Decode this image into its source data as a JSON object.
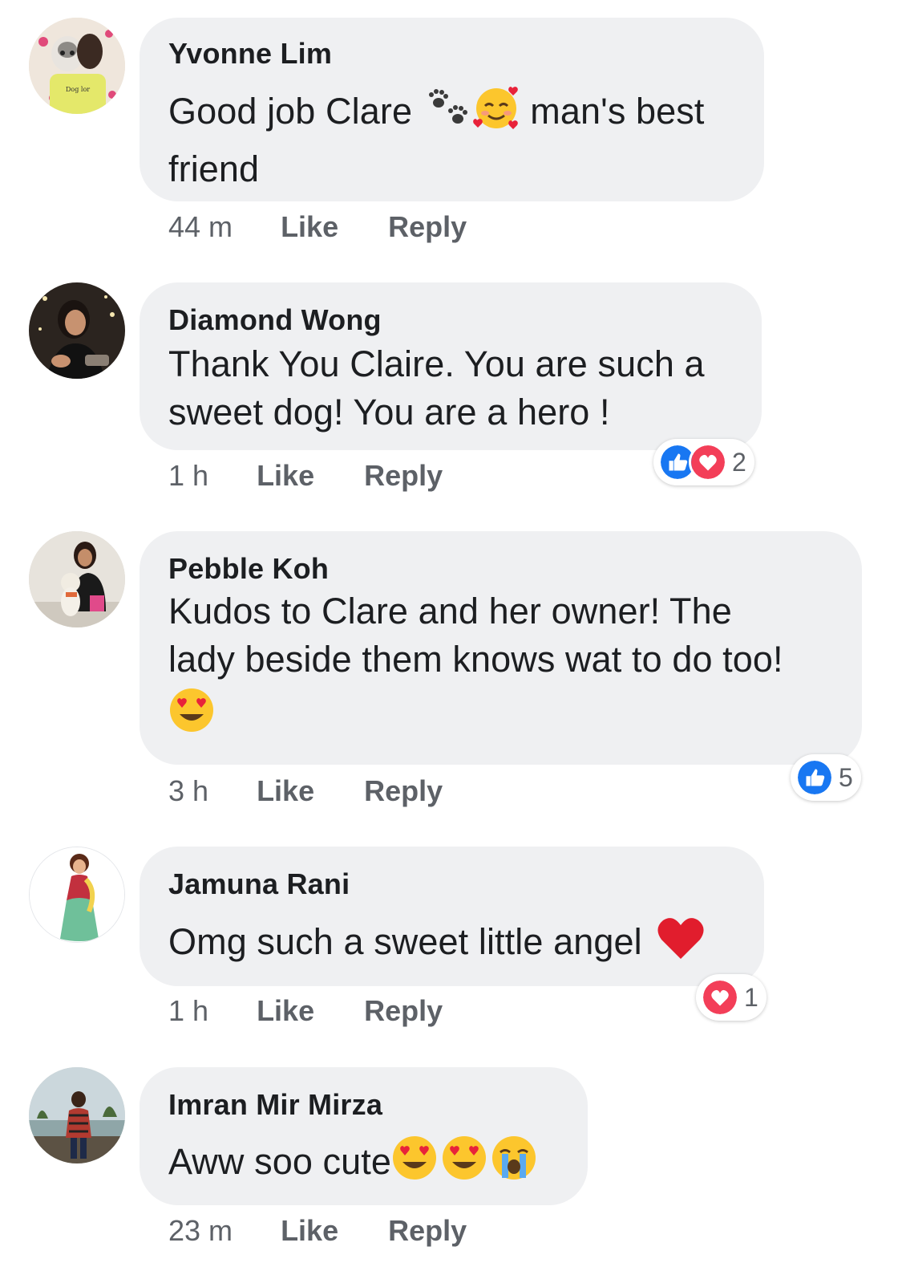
{
  "comments": [
    {
      "author": "Yvonne Lim",
      "text_lines": [
        "Good job Clare",
        "man's best",
        "friend"
      ],
      "time": "44 m",
      "like": "Like",
      "reply": "Reply"
    },
    {
      "author": "Diamond Wong",
      "text_lines": [
        "Thank You Claire. You are such a",
        "sweet dog! You are a hero !"
      ],
      "time": "1 h",
      "like": "Like",
      "reply": "Reply",
      "reactions": {
        "types": [
          "like-icon",
          "love-icon"
        ],
        "count": "2"
      }
    },
    {
      "author": "Pebble Koh",
      "text_lines": [
        "Kudos to Clare and her owner! The",
        "lady beside them knows wat to do too!"
      ],
      "time": "3 h",
      "like": "Like",
      "reply": "Reply",
      "reactions": {
        "types": [
          "like-icon"
        ],
        "count": "5"
      }
    },
    {
      "author": "Jamuna Rani",
      "text_lines": [
        "Omg such a sweet little angel"
      ],
      "time": "1 h",
      "like": "Like",
      "reply": "Reply",
      "reactions": {
        "types": [
          "love-icon"
        ],
        "count": "1"
      }
    },
    {
      "author": "Imran Mir Mirza",
      "text_lines": [
        "Aww soo cute"
      ],
      "time": "23 m",
      "like": "Like",
      "reply": "Reply"
    }
  ],
  "colors": {
    "bubble": "#eff0f2",
    "text": "#1c1e21",
    "meta": "#5d6167",
    "like_blue": "#1877f2",
    "love_red": "#f33e58"
  }
}
